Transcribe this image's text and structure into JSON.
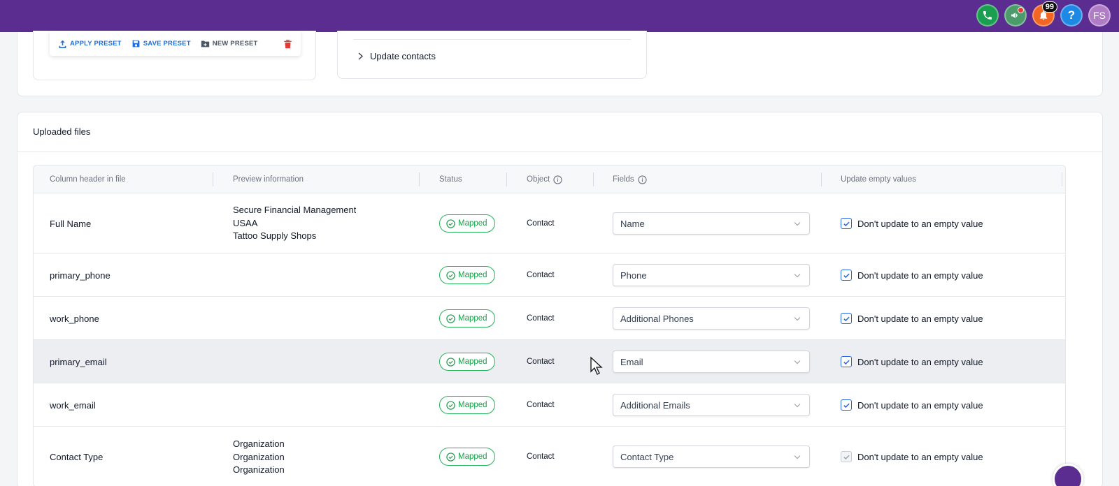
{
  "topbar": {
    "notification_count": "99",
    "help_label": "?",
    "avatar_initials": "FS",
    "colors": {
      "bar": "#5b2d91",
      "phone": "#1a9e4f",
      "bell": "#f26522",
      "help": "#1e88e5"
    }
  },
  "preset_toolbar": {
    "apply_label": "APPLY PRESET",
    "save_label": "SAVE PRESET",
    "new_label": "NEW PRESET"
  },
  "update_contacts": {
    "label": "Update contacts"
  },
  "uploaded_files": {
    "title": "Uploaded files",
    "columns": {
      "header": "Column header in file",
      "preview": "Preview information",
      "status": "Status",
      "object": "Object",
      "fields": "Fields",
      "update": "Update empty values"
    },
    "rows": [
      {
        "name": "Full Name",
        "preview": [
          "Secure Financial Management",
          "USAA",
          "Tattoo Supply Shops"
        ],
        "status": "Mapped",
        "object": "Contact",
        "field": "Name",
        "update_label": "Don't update to an empty value",
        "checked": true
      },
      {
        "name": "primary_phone",
        "preview": [],
        "status": "Mapped",
        "object": "Contact",
        "field": "Phone",
        "update_label": "Don't update to an empty value",
        "checked": true
      },
      {
        "name": "work_phone",
        "preview": [],
        "status": "Mapped",
        "object": "Contact",
        "field": "Additional Phones",
        "update_label": "Don't update to an empty value",
        "checked": true
      },
      {
        "name": "primary_email",
        "preview": [],
        "status": "Mapped",
        "object": "Contact",
        "field": "Email",
        "update_label": "Don't update to an empty value",
        "checked": true
      },
      {
        "name": "work_email",
        "preview": [],
        "status": "Mapped",
        "object": "Contact",
        "field": "Additional Emails",
        "update_label": "Don't update to an empty value",
        "checked": true
      },
      {
        "name": "Contact Type",
        "preview": [
          "Organization",
          "Organization",
          "Organization"
        ],
        "status": "Mapped",
        "object": "Contact",
        "field": "Contact Type",
        "update_label": "Don't update to an empty value",
        "checked": true,
        "disabled": true
      }
    ]
  }
}
